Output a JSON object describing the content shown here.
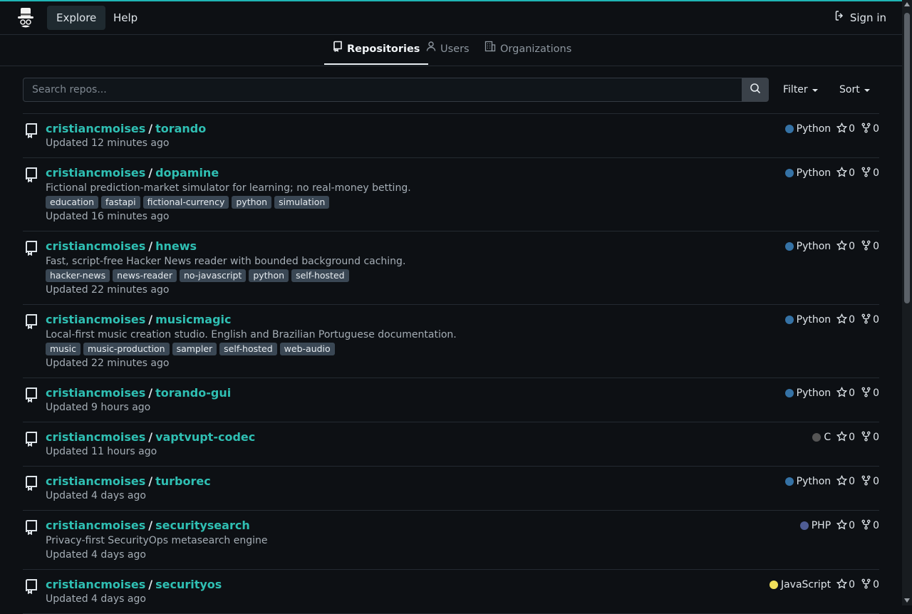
{
  "nav": {
    "explore_label": "Explore",
    "help_label": "Help",
    "signin_label": "Sign in",
    "logo_icon": "top-hat-logo-icon",
    "signin_icon": "sign-in-icon"
  },
  "tabs": [
    {
      "label": "Repositories",
      "icon": "repo-icon",
      "active": true
    },
    {
      "label": "Users",
      "icon": "user-icon",
      "active": false
    },
    {
      "label": "Organizations",
      "icon": "organization-icon",
      "active": false
    }
  ],
  "search": {
    "placeholder": "Search repos...",
    "value": "",
    "button_icon": "search-icon"
  },
  "filter_label": "Filter",
  "sort_label": "Sort",
  "colors": {
    "accent": "#2fbfb3",
    "topline": "#1fb5b5",
    "python": "#3572A5",
    "c": "#555555",
    "php": "#4F5D95",
    "javascript": "#f1e05a"
  },
  "repos": [
    {
      "owner": "cristiancmoises",
      "name": "torando",
      "description": "",
      "topics": [],
      "updated": "Updated 12 minutes ago",
      "language": "Python",
      "lang_color": "#3572A5",
      "stars": "0",
      "forks": "0"
    },
    {
      "owner": "cristiancmoises",
      "name": "dopamine",
      "description": "Fictional prediction-market simulator for learning; no real-money betting.",
      "topics": [
        "education",
        "fastapi",
        "fictional-currency",
        "python",
        "simulation"
      ],
      "updated": "Updated 16 minutes ago",
      "language": "Python",
      "lang_color": "#3572A5",
      "stars": "0",
      "forks": "0"
    },
    {
      "owner": "cristiancmoises",
      "name": "hnews",
      "description": "Fast, script-free Hacker News reader with bounded background caching.",
      "topics": [
        "hacker-news",
        "news-reader",
        "no-javascript",
        "python",
        "self-hosted"
      ],
      "updated": "Updated 22 minutes ago",
      "language": "Python",
      "lang_color": "#3572A5",
      "stars": "0",
      "forks": "0"
    },
    {
      "owner": "cristiancmoises",
      "name": "musicmagic",
      "description": "Local-first music creation studio. English and Brazilian Portuguese documentation.",
      "topics": [
        "music",
        "music-production",
        "sampler",
        "self-hosted",
        "web-audio"
      ],
      "updated": "Updated 22 minutes ago",
      "language": "Python",
      "lang_color": "#3572A5",
      "stars": "0",
      "forks": "0"
    },
    {
      "owner": "cristiancmoises",
      "name": "torando-gui",
      "description": "",
      "topics": [],
      "updated": "Updated 9 hours ago",
      "language": "Python",
      "lang_color": "#3572A5",
      "stars": "0",
      "forks": "0"
    },
    {
      "owner": "cristiancmoises",
      "name": "vaptvupt-codec",
      "description": "",
      "topics": [],
      "updated": "Updated 11 hours ago",
      "language": "C",
      "lang_color": "#555555",
      "stars": "0",
      "forks": "0"
    },
    {
      "owner": "cristiancmoises",
      "name": "turborec",
      "description": "",
      "topics": [],
      "updated": "Updated 4 days ago",
      "language": "Python",
      "lang_color": "#3572A5",
      "stars": "0",
      "forks": "0"
    },
    {
      "owner": "cristiancmoises",
      "name": "securitysearch",
      "description": "Privacy-first SecurityOps metasearch engine",
      "topics": [],
      "updated": "Updated 4 days ago",
      "language": "PHP",
      "lang_color": "#4F5D95",
      "stars": "0",
      "forks": "0"
    },
    {
      "owner": "cristiancmoises",
      "name": "securityos",
      "description": "",
      "topics": [],
      "updated": "Updated 4 days ago",
      "language": "JavaScript",
      "lang_color": "#f1e05a",
      "stars": "0",
      "forks": "0"
    }
  ]
}
